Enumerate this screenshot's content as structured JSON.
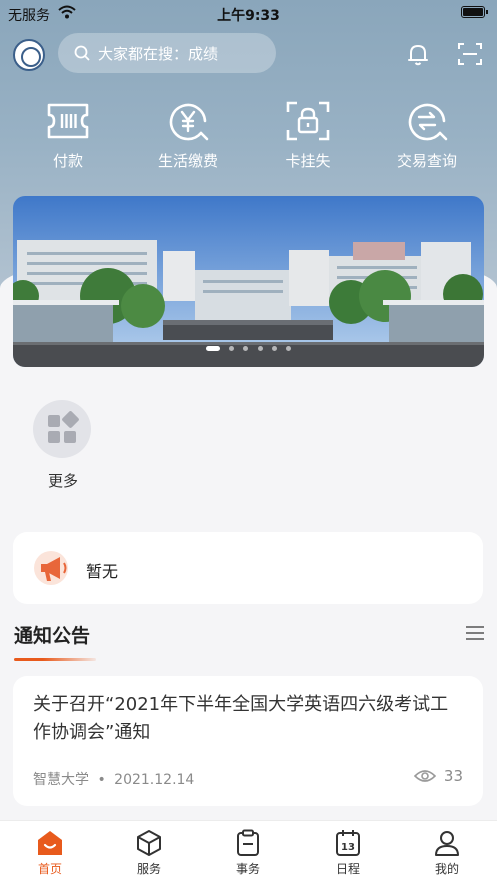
{
  "status_bar": {
    "carrier": "无服务",
    "time": "上午9:33"
  },
  "header": {
    "search_placeholder": "大家都在搜：成绩",
    "icons": [
      "university-logo",
      "search-icon",
      "bell-icon",
      "scan-icon"
    ]
  },
  "quick_actions": [
    {
      "label": "付款",
      "icon": "payment-card-icon"
    },
    {
      "label": "生活缴费",
      "icon": "yen-coin-icon"
    },
    {
      "label": "卡挂失",
      "icon": "card-lock-icon"
    },
    {
      "label": "交易查询",
      "icon": "transaction-search-icon"
    }
  ],
  "banner": {
    "slide_count": 6,
    "active_index": 0
  },
  "apps": {
    "more_label": "更多"
  },
  "notice": {
    "text": "暂无"
  },
  "announcements": {
    "section_title": "通知公告",
    "items": [
      {
        "title": "关于召开“2021年下半年全国大学英语四六级考试工作协调会”通知",
        "source": "智慧大学",
        "separator": "•",
        "date": "2021.12.14",
        "views": "33"
      }
    ]
  },
  "tab_bar": [
    {
      "label": "首页",
      "active": true
    },
    {
      "label": "服务",
      "active": false
    },
    {
      "label": "事务",
      "active": false
    },
    {
      "label": "日程",
      "active": false,
      "icon_number": "13"
    },
    {
      "label": "我的",
      "active": false
    }
  ],
  "colors": {
    "accent": "#e85a1c",
    "header_bg": "#98b1c4"
  }
}
